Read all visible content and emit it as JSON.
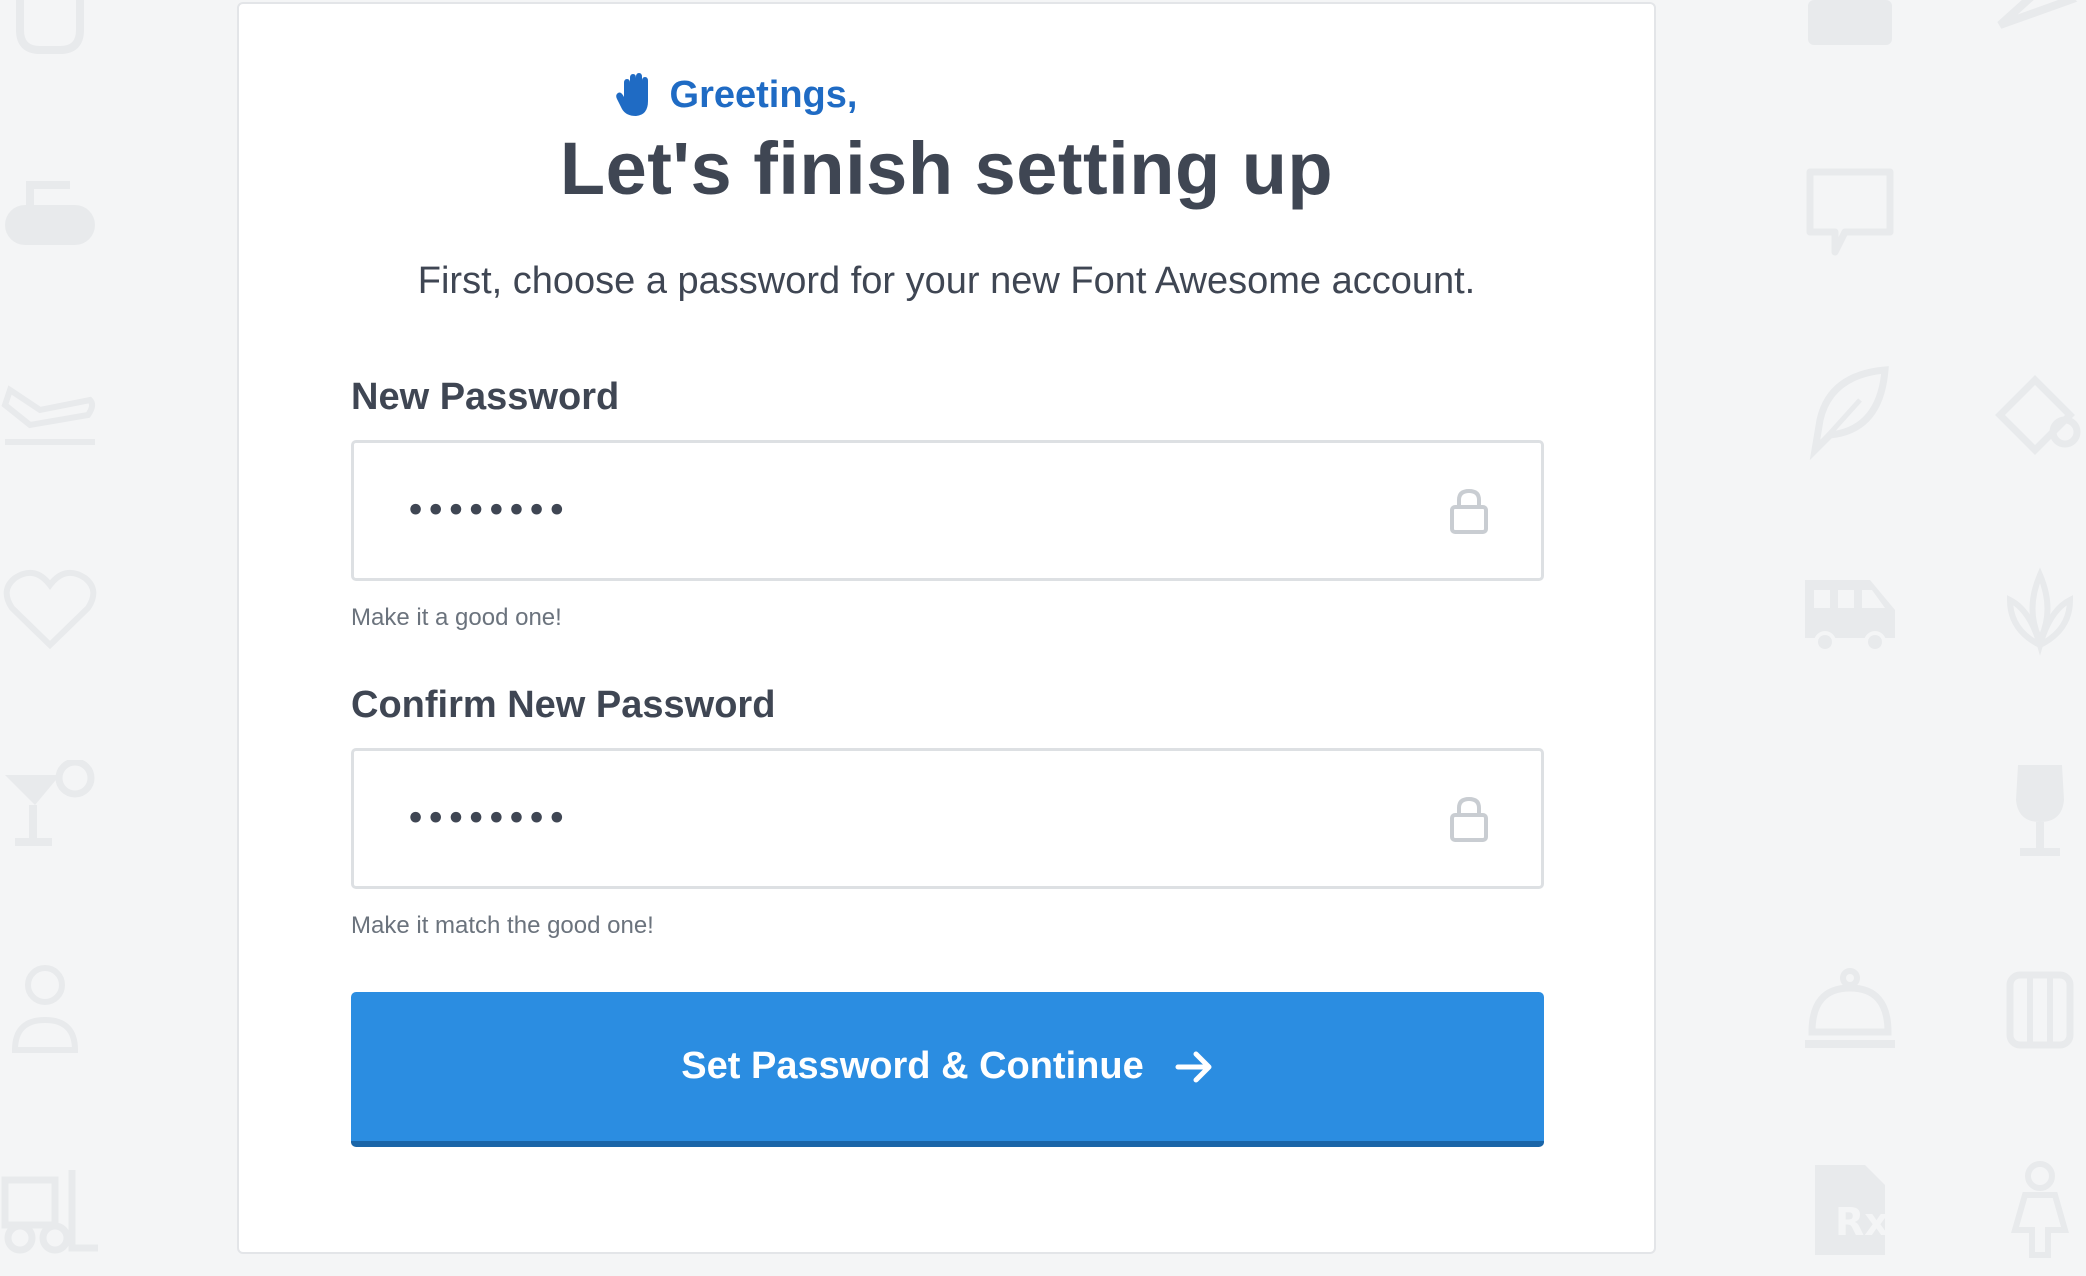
{
  "greeting": {
    "prefix": "Greetings,",
    "icon": "hand-paper-icon"
  },
  "title": "Let's finish setting up",
  "subtitle": "First, choose a password for your new Font Awesome account.",
  "new_password": {
    "label": "New Password",
    "value": "••••••••",
    "help": "Make it a good one!",
    "icon": "lock-icon"
  },
  "confirm_password": {
    "label": "Confirm New Password",
    "value": "••••••••",
    "help": "Make it match the good one!",
    "icon": "lock-icon"
  },
  "submit": {
    "label": "Set Password & Continue",
    "icon": "arrow-right-icon"
  },
  "colors": {
    "accent": "#2b8de1",
    "greeting": "#1f6bc4",
    "text": "#3f4653",
    "background": "#f4f5f6"
  }
}
